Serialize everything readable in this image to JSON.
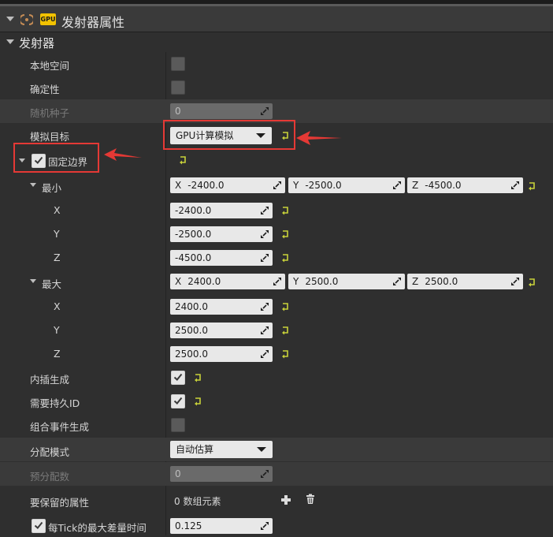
{
  "section": {
    "title": "发射器属性",
    "badge": "GPU"
  },
  "group": {
    "title": "发射器"
  },
  "rows": {
    "local_space": {
      "label": "本地空间",
      "checked": false
    },
    "determinism": {
      "label": "确定性",
      "checked": false
    },
    "random_seed": {
      "label": "随机种子",
      "value": "0"
    },
    "sim_target": {
      "label": "模拟目标",
      "value": "GPU计算模拟"
    },
    "fixed_bounds": {
      "label": "固定边界",
      "checked": true
    },
    "min": {
      "label": "最小",
      "x": "-2400.0",
      "y": "-2500.0",
      "z": "-4500.0"
    },
    "max": {
      "label": "最大",
      "x": "2400.0",
      "y": "2500.0",
      "z": "2500.0"
    },
    "axis_labels": {
      "x": "X",
      "y": "Y",
      "z": "Z"
    },
    "interpolated_spawn": {
      "label": "内插生成",
      "checked": true
    },
    "requires_persistent_id": {
      "label": "需要持久ID",
      "checked": true
    },
    "combine_event_spawn": {
      "label": "组合事件生成",
      "checked": false
    },
    "alloc_mode": {
      "label": "分配模式",
      "value": "自动估算"
    },
    "pre_alloc_count": {
      "label": "预分配数",
      "value": "0"
    },
    "attrs_to_preserve": {
      "label": "要保留的属性",
      "value": "0 数组元素"
    },
    "max_delta_per_tick": {
      "label": "每Tick的最大差量时间",
      "value": "0.125",
      "checked": true
    }
  },
  "colors": {
    "highlight": "#e53935",
    "reset": "#c8d23a",
    "badge": "#f2c200"
  },
  "icons": [
    "emitter-icon",
    "checkmark-icon",
    "drag-handle-icon",
    "reset-arrow-icon",
    "add-icon",
    "trash-icon",
    "dropdown-caret-icon",
    "expand-triangle-icon"
  ]
}
